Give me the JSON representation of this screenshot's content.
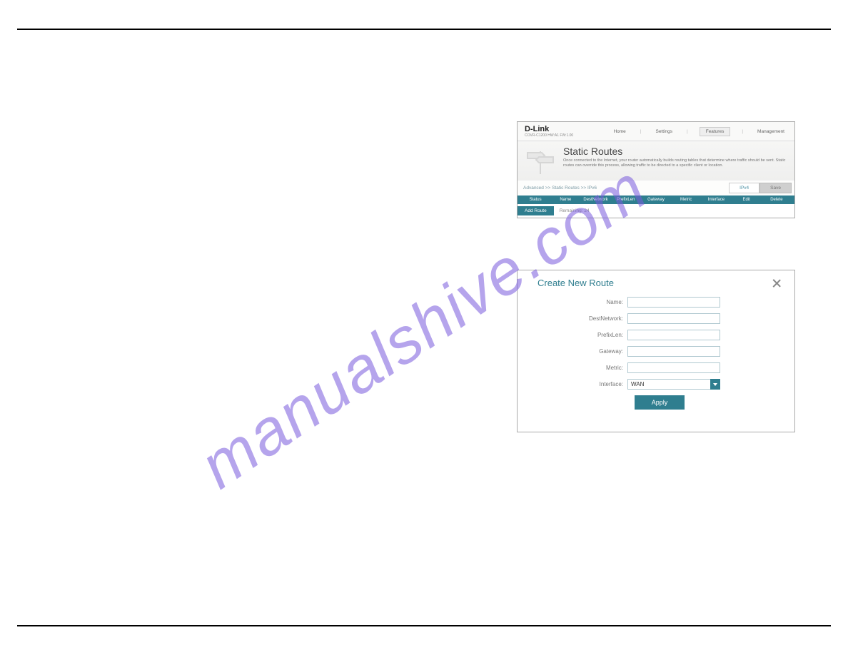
{
  "watermark": "manualshive.com",
  "ui_top": {
    "brand": "D-Link",
    "brand_sub": "COVR-C1200 HW:A1 FW:1.00",
    "nav": {
      "home": "Home",
      "settings": "Settings",
      "features": "Features",
      "management": "Management"
    },
    "title": "Static Routes",
    "desc": "Once connected to the Internet, your router automatically builds routing tables that determine where traffic should be sent. Static routes can override this process, allowing traffic to be directed to a specific client or location.",
    "crumbs": "Advanced >> Static Routes >> IPv6",
    "btn_ipv4": "IPv4",
    "btn_save": "Save",
    "columns": [
      "Status",
      "Name",
      "DestNetwork",
      "PrefixLen",
      "Gateway",
      "Metric",
      "Interface",
      "Edit",
      "Delete"
    ],
    "btn_add": "Add Route",
    "remaining": "Remaining: 24"
  },
  "dialog": {
    "title": "Create New Route",
    "fields": {
      "name": "Name:",
      "dest": "DestNetwork:",
      "prefix": "PrefixLen:",
      "gateway": "Gateway:",
      "metric": "Metric:",
      "interface": "Interface:"
    },
    "interface_value": "WAN",
    "apply": "Apply"
  }
}
